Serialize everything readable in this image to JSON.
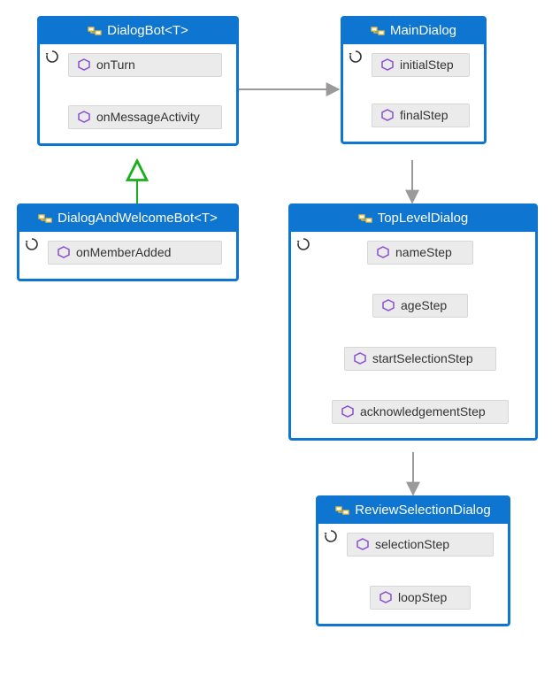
{
  "nodes": {
    "dialogBot": {
      "title": "DialogBot<T>",
      "methods": [
        "onTurn",
        "onMessageActivity"
      ]
    },
    "dialogWelcomeBot": {
      "title": "DialogAndWelcomeBot<T>",
      "methods": [
        "onMemberAdded"
      ]
    },
    "mainDialog": {
      "title": "MainDialog",
      "methods": [
        "initialStep",
        "finalStep"
      ]
    },
    "topLevelDialog": {
      "title": "TopLevelDialog",
      "methods": [
        "nameStep",
        "ageStep",
        "startSelectionStep",
        "acknowledgementStep"
      ]
    },
    "reviewSelectionDialog": {
      "title": "ReviewSelectionDialog",
      "methods": [
        "selectionStep",
        "loopStep"
      ]
    }
  }
}
